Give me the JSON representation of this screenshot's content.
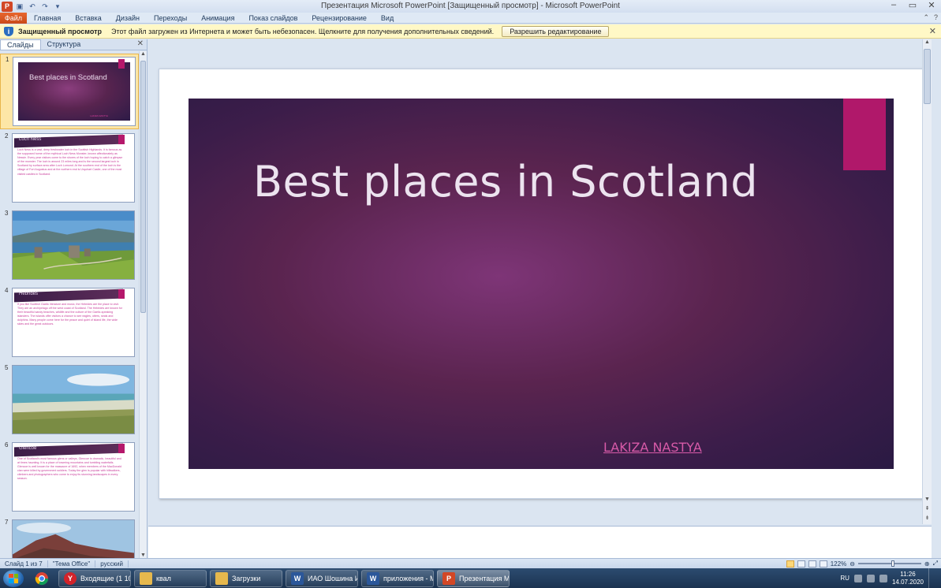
{
  "window": {
    "title": "Презентация Microsoft PowerPoint [Защищенный просмотр] - Microsoft PowerPoint"
  },
  "ribbon": {
    "file_tab": "Файл",
    "tabs": [
      "Главная",
      "Вставка",
      "Дизайн",
      "Переходы",
      "Анимация",
      "Показ слайдов",
      "Рецензирование",
      "Вид"
    ]
  },
  "protected_view": {
    "title": "Защищенный просмотр",
    "message": "Этот файл загружен из Интернета и может быть небезопасен. Щелкните для получения дополнительных сведений.",
    "button": "Разрешить редактирование"
  },
  "left_panel": {
    "tabs": [
      "Слайды",
      "Структура"
    ],
    "slides": [
      {
        "num": "1",
        "kind": "title",
        "title": "Best places in Scotland",
        "name": "LAKIZA NASTYA"
      },
      {
        "num": "2",
        "kind": "text",
        "title": "Loch Ness",
        "body": "Loch Ness is a vast, deep freshwater loch in the Scottish Highlands. It is famous as the supposed home of the mythical Loch Ness Monster, known affectionately as Nessie. Every year visitors come to the shores of the loch hoping to catch a glimpse of the monster. The loch is around 23 miles long and is the second largest loch in Scotland by surface area after Loch Lomond. At the southern end of the loch is the village of Fort Augustus and at the northern end is Urquhart Castle, one of the most visited castles in Scotland."
      },
      {
        "num": "3",
        "kind": "photo-castle"
      },
      {
        "num": "4",
        "kind": "text",
        "title": "Hebrides",
        "body": "If you like Scottish Gaelic literature and music, the Hebrides are the place to visit. They are an archipelago off the west coast of Scotland. The Hebrides are known for their beautiful sandy beaches, wildlife and the culture of the Gaelic-speaking islanders. The islands offer visitors a chance to see eagles, otters, seals and dolphins. Many people come here for the peace and quiet of island life, the wide skies and the great outdoors."
      },
      {
        "num": "5",
        "kind": "photo-beach"
      },
      {
        "num": "6",
        "kind": "text",
        "title": "Glencoe",
        "body": "One of Scotland's most famous glens or valleys, Glencoe is dramatic, beautiful and at times haunting. It is a place of towering mountains and tumbling waterfalls. Glencoe is well known for the massacre of 1692, when members of the MacDonald clan were killed by government soldiers. Today the glen is popular with hillwalkers, climbers and photographers who come to enjoy its stunning landscapes in every season."
      },
      {
        "num": "7",
        "kind": "photo-mountain"
      }
    ]
  },
  "main_slide": {
    "title": "Best places in Scotland",
    "name_first": "LAKIZA",
    "name_last": "NASTYA"
  },
  "status": {
    "slide_info": "Слайд 1 из 7",
    "theme": "\"Тема Office\"",
    "language": "русский",
    "zoom": "122%"
  },
  "taskbar": {
    "items": [
      {
        "label": "Входящие (1 103)...",
        "icon_color": "#d2232a"
      },
      {
        "label": "квал",
        "icon_color": "#e6b84d"
      },
      {
        "label": "Загрузки",
        "icon_color": "#e6b84d"
      },
      {
        "label": "ИАО Шошина И...",
        "icon_color": "#2b579a"
      },
      {
        "label": "приложения - Mi...",
        "icon_color": "#2b579a"
      },
      {
        "label": "Презентация Mic...",
        "icon_color": "#d24726"
      }
    ],
    "tray": {
      "lang": "RU",
      "time": "11:26",
      "date": "14.07.2020"
    }
  },
  "colors": {
    "accent_pink": "#b0186a",
    "slide_bg": "#5a244f",
    "file_tab": "#d24726"
  }
}
